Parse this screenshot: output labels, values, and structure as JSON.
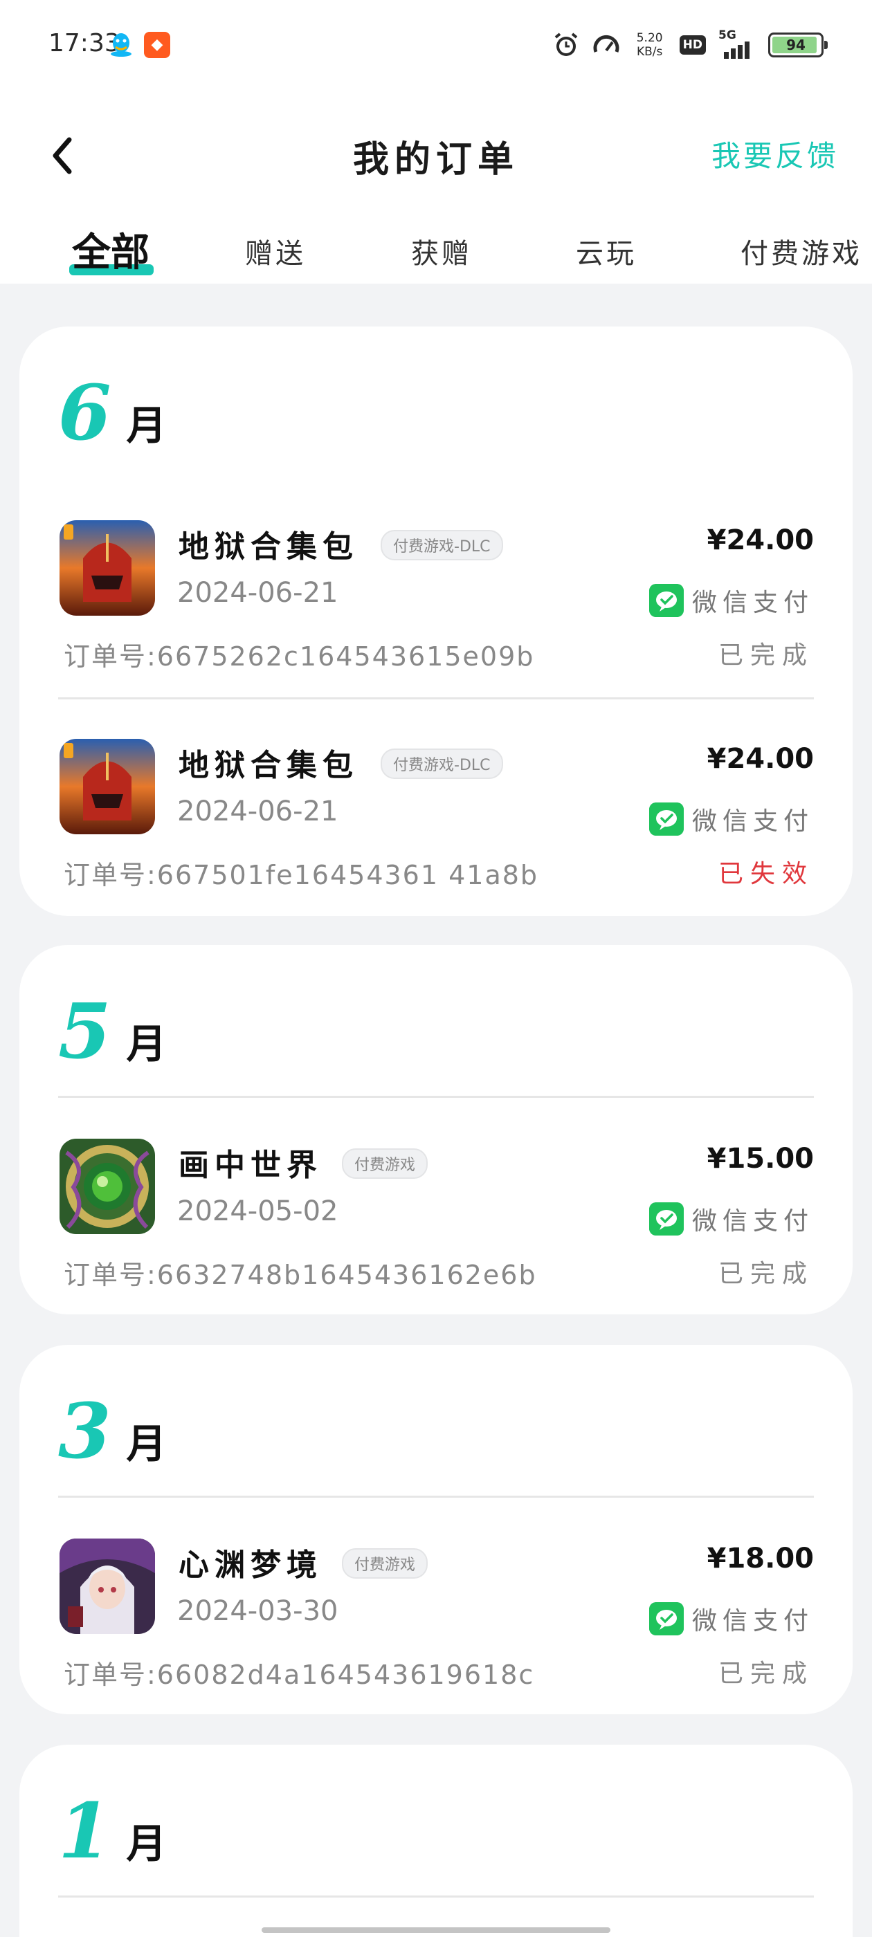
{
  "status_bar": {
    "time": "17:33",
    "network_speed": "5.20",
    "network_speed_unit": "KB/s",
    "hd_label": "HD",
    "signal_label": "5G",
    "battery_level": 94,
    "battery_text": "94",
    "icons": [
      "qq-icon",
      "app-notification-icon",
      "alarm-icon",
      "speedometer-icon",
      "signal-icon",
      "battery-icon"
    ]
  },
  "header": {
    "title": "我的订单",
    "feedback_label": "我要反馈",
    "back_icon": "chevron-left-icon"
  },
  "tabs": [
    {
      "label": "全部",
      "active": true
    },
    {
      "label": "赠送",
      "active": false
    },
    {
      "label": "获赠",
      "active": false
    },
    {
      "label": "云玩",
      "active": false
    },
    {
      "label": "付费游戏",
      "active": false
    }
  ],
  "accent_color": "#19c7b4",
  "wechat_pay_color": "#1fc35c",
  "fail_color": "#e0373c",
  "groups": [
    {
      "month_num": "6",
      "month_unit": "月",
      "orders": [
        {
          "name": "地狱合集包",
          "tag": "付费游戏-DLC",
          "date": "2024-06-21",
          "price": "¥24.00",
          "payment": "微信支付",
          "order_no": "订单号:6675262c164543615e09b",
          "status": "已完成",
          "status_type": "done"
        },
        {
          "name": "地狱合集包",
          "tag": "付费游戏-DLC",
          "date": "2024-06-21",
          "price": "¥24.00",
          "payment": "微信支付",
          "order_no": "订单号:667501fe16454361 41a8b",
          "status": "已失效",
          "status_type": "fail"
        }
      ]
    },
    {
      "month_num": "5",
      "month_unit": "月",
      "orders": [
        {
          "name": "画中世界",
          "tag": "付费游戏",
          "date": "2024-05-02",
          "price": "¥15.00",
          "payment": "微信支付",
          "order_no": "订单号:6632748b1645436162e6b",
          "status": "已完成",
          "status_type": "done"
        }
      ]
    },
    {
      "month_num": "3",
      "month_unit": "月",
      "orders": [
        {
          "name": "心渊梦境",
          "tag": "付费游戏",
          "date": "2024-03-30",
          "price": "¥18.00",
          "payment": "微信支付",
          "order_no": "订单号:66082d4a164543619618c",
          "status": "已完成",
          "status_type": "done"
        }
      ]
    },
    {
      "month_num": "1",
      "month_unit": "月",
      "orders": []
    }
  ]
}
